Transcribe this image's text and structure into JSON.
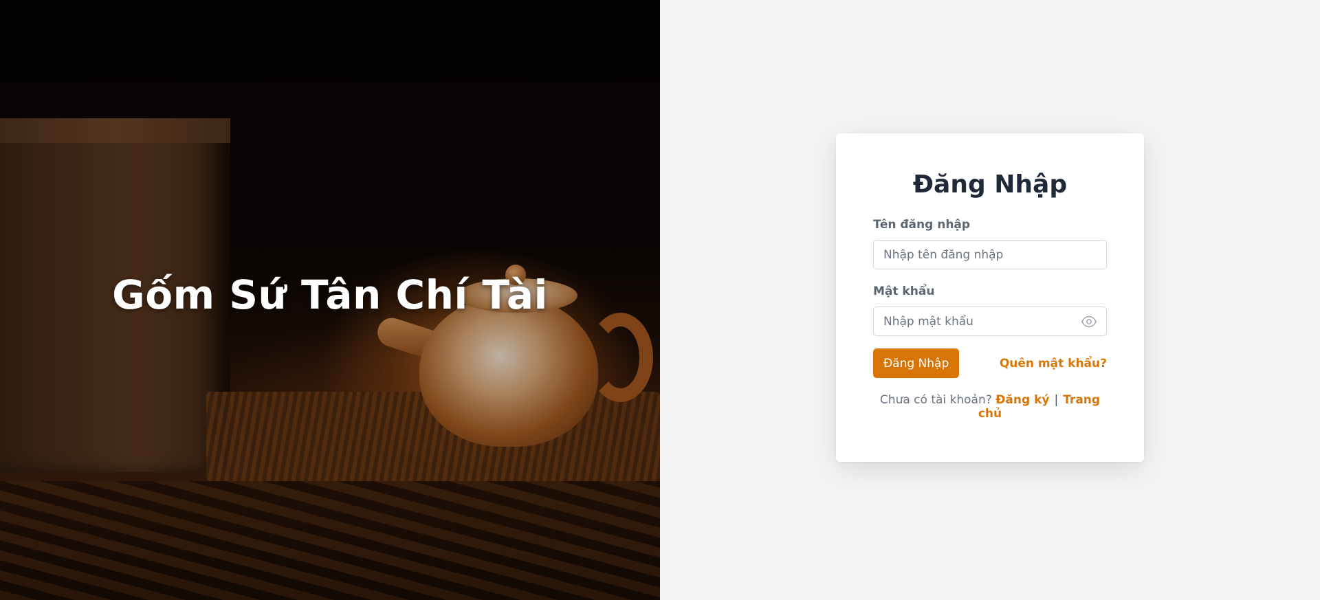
{
  "hero": {
    "title": "Gốm Sứ Tân Chí Tài",
    "image_alt": "teapot"
  },
  "login": {
    "title": "Đăng Nhập",
    "username_label": "Tên đăng nhập",
    "username_placeholder": "Nhập tên đăng nhập",
    "username_value": "",
    "password_label": "Mật khẩu",
    "password_placeholder": "Nhập mật khẩu",
    "password_value": "",
    "password_toggle_icon": "eye-icon",
    "submit_label": "Đăng Nhập",
    "forgot_label": "Quên mật khẩu?",
    "no_account_text": "Chưa có tài khoản?",
    "register_label": "Đăng ký",
    "separator": "|",
    "home_label": "Trang chủ"
  },
  "colors": {
    "accent": "#d77607",
    "page_bg": "#f4f4f4",
    "card_bg": "#ffffff",
    "title_text": "#1f2937"
  }
}
